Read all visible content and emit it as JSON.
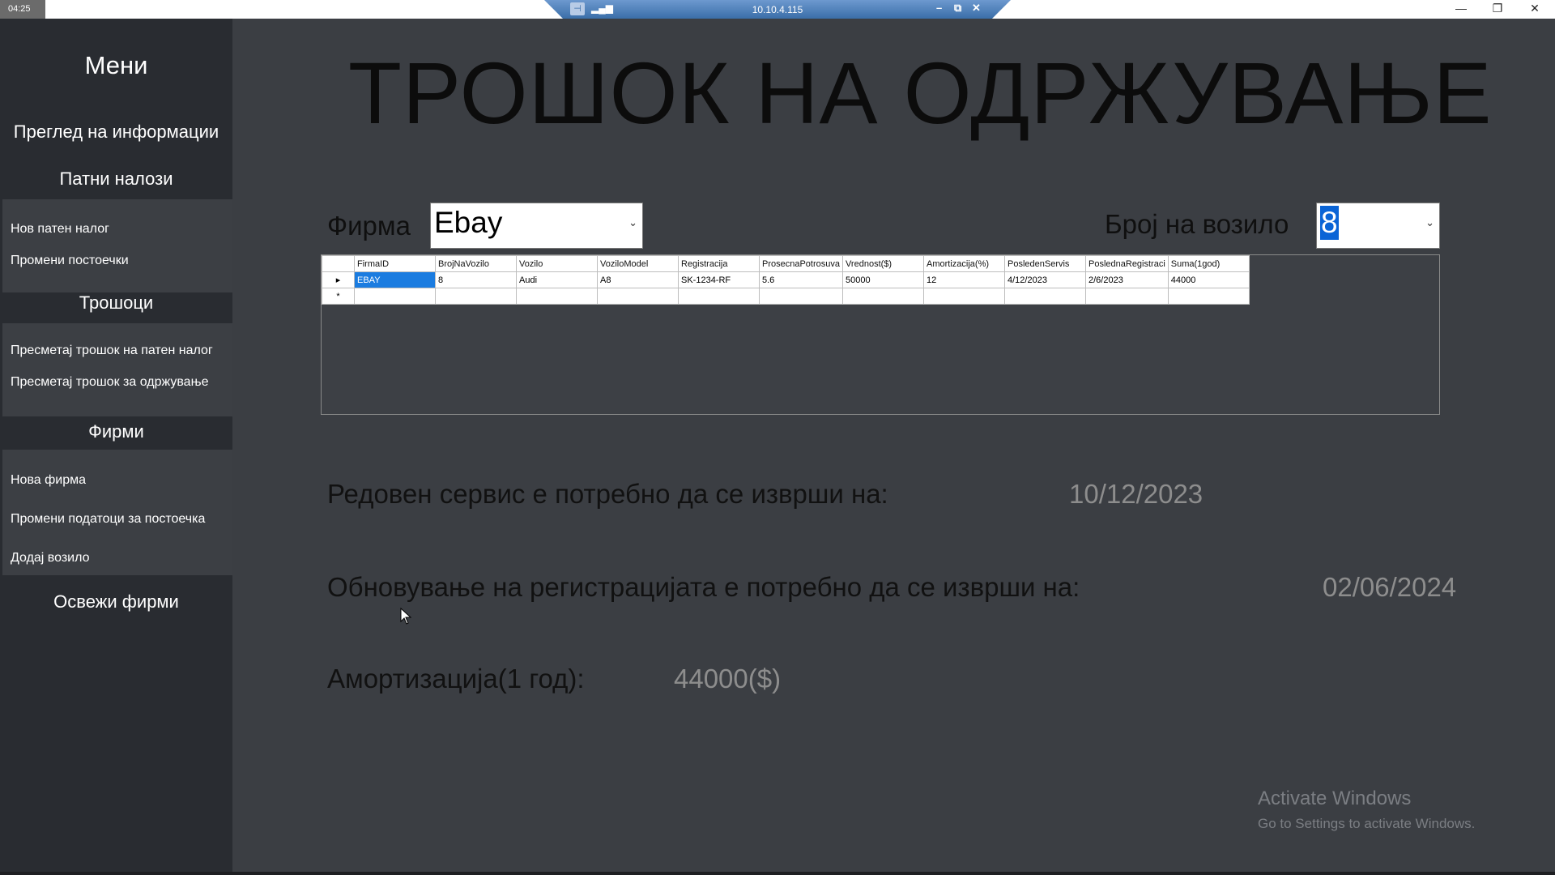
{
  "topbar": {
    "clock": "04:25",
    "remote_ip": "10.10.4.115",
    "rd_minimize": "–",
    "rd_restore": "⧉",
    "rd_close": "✕",
    "win_minimize": "—",
    "win_restore": "❐",
    "win_close": "✕"
  },
  "sidebar": {
    "menu_title": "Мени",
    "overview": "Преглед на информации",
    "travel_orders_heading": "Патни налози",
    "new_order": "Нов патен налог",
    "edit_existing": "Промени постоечки",
    "costs_heading": "Трошоци",
    "calc_order_cost": "Пресметај трошок на патен налог",
    "calc_maintenance_cost": "Пресметај трошок за одржување",
    "companies_heading": "Фирми",
    "new_company": "Нова фирма",
    "edit_company": "Промени податоци за постоечка",
    "add_vehicle": "Додај возило",
    "refresh_companies": "Освежи фирми"
  },
  "main": {
    "title": "ТРОШОК НА ОДРЖУВАЊЕ",
    "company_label": "Фирма",
    "company_value": "Ebay",
    "vehicle_label": "Број на возило",
    "vehicle_value": "8"
  },
  "grid": {
    "columns": [
      "FirmaID",
      "BrojNaVozilo",
      "Vozilo",
      "VoziloModel",
      "Registracija",
      "ProsecnaPotrosuva",
      "Vrednost($)",
      "Amortizacija(%)",
      "PosledenServis",
      "PoslednaRegistraci",
      "Suma(1god)"
    ],
    "rows": [
      [
        "EBAY",
        "8",
        "Audi",
        "A8",
        "SK-1234-RF",
        "5.6",
        "50000",
        "12",
        "4/12/2023",
        "2/6/2023",
        "44000"
      ]
    ],
    "row_marker": "▸",
    "new_row_marker": "*"
  },
  "info": {
    "service_label": "Редовен сервис е потребно да се изврши на:",
    "service_value": "10/12/2023",
    "registration_label": "Обновување на регистрацијата е потребно да се изврши на:",
    "registration_value": "02/06/2024",
    "amortization_label": "Амортизација(1 год):",
    "amortization_value": "44000($)"
  },
  "watermark": {
    "line1": "Activate Windows",
    "line2": "Go to Settings to activate Windows."
  },
  "colors": {
    "main_bg": "#3b3e43",
    "sidebar_bg": "#292c31",
    "selection": "#1b7ce0"
  }
}
